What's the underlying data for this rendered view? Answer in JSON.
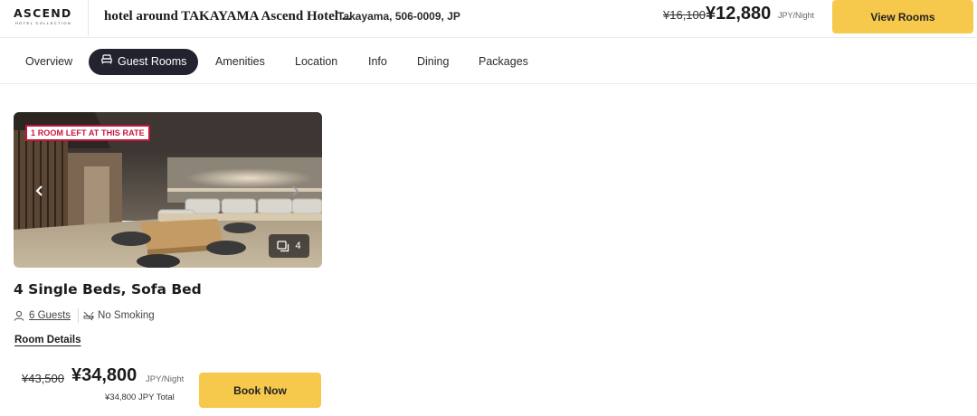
{
  "brand": {
    "logo_text": "ASCEND",
    "logo_subtext": "HOTEL COLLECTION"
  },
  "header": {
    "hotel_name": "hotel around TAKAYAMA Ascend Hotel ...",
    "location": "Takayama, 506-0009, JP",
    "original_price": "¥16,100",
    "price": "¥12,880",
    "price_unit": "JPY/Night",
    "view_rooms_label": "View Rooms"
  },
  "tabs": [
    {
      "label": "Overview",
      "active": false
    },
    {
      "label": "Guest Rooms",
      "active": true,
      "icon": "bed-icon"
    },
    {
      "label": "Amenities",
      "active": false
    },
    {
      "label": "Location",
      "active": false
    },
    {
      "label": "Info",
      "active": false
    },
    {
      "label": "Dining",
      "active": false
    },
    {
      "label": "Packages",
      "active": false
    }
  ],
  "room": {
    "badge": "1 ROOM LEFT AT THIS RATE",
    "photo_count": "4",
    "title": "4 Single Beds, Sofa Bed",
    "guests": "6 Guests",
    "smoking": "No Smoking",
    "details_link": "Room Details",
    "original_price": "¥43,500",
    "price": "¥34,800",
    "price_unit": "JPY/Night",
    "total": "¥34,800  JPY Total",
    "book_label": "Book Now"
  },
  "colors": {
    "accent_button": "#f6c94c",
    "active_tab": "#23232f",
    "badge": "#c8143c"
  },
  "icons": [
    "bed-icon",
    "chevron-left-icon",
    "chevron-right-icon",
    "gallery-icon",
    "person-icon",
    "no-smoking-icon"
  ]
}
